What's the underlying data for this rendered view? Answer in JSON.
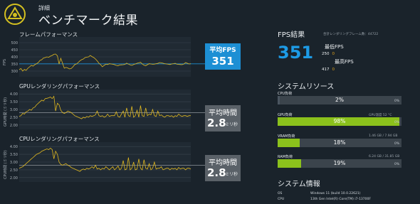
{
  "header": {
    "subtitle": "詳細",
    "title": "ベンチマーク結果"
  },
  "left": {
    "frame": {
      "title": "フレームパフォーマンス",
      "ylabel": "FPS",
      "ticks": [
        "500",
        "450",
        "400",
        "350",
        "300"
      ],
      "stat_label": "平均FPS",
      "stat_value": "351",
      "series": [
        310,
        318,
        300,
        312,
        305,
        320,
        330,
        340,
        335,
        345,
        352,
        360,
        375,
        380,
        392,
        395,
        400,
        397,
        405,
        410,
        418,
        420,
        408,
        350,
        390,
        355,
        320,
        326,
        322,
        315,
        318,
        330,
        345,
        350,
        360,
        372,
        380,
        385,
        395,
        398,
        400,
        410,
        402,
        395,
        385,
        372,
        355,
        345,
        330,
        340,
        348,
        346,
        352,
        350,
        348,
        345,
        340,
        338,
        343,
        344,
        345,
        347,
        356,
        349,
        344,
        340,
        346,
        350,
        355,
        358,
        362,
        350,
        341,
        338,
        345,
        352,
        350,
        348,
        349,
        352,
        354,
        360,
        358,
        355,
        352,
        350,
        348,
        346,
        350,
        352,
        355,
        348,
        347,
        346,
        345,
        350,
        360,
        355,
        350,
        352
      ]
    },
    "gpu": {
      "title": "GPUレンダリングパフォーマンス",
      "ylabel": "GPU時間 (ミリ秒)",
      "ticks": [
        "4.00",
        "3.50",
        "3.00",
        "2.50",
        "2.00"
      ],
      "stat_label": "平均時間",
      "stat_value": "2.8",
      "stat_unit": "ミリ秒",
      "series": [
        2.55,
        2.6,
        2.75,
        2.7,
        2.85,
        2.9,
        3.0,
        2.95,
        3.1,
        3.15,
        3.3,
        3.4,
        3.5,
        3.6,
        3.55,
        3.7,
        3.72,
        3.75,
        3.8,
        3.7,
        3.85,
        2.9,
        3.4,
        3.3,
        2.95,
        2.8,
        2.75,
        2.8,
        2.9,
        2.85,
        2.8,
        2.7,
        2.6,
        2.55,
        2.5,
        2.45,
        2.4,
        2.5,
        2.45,
        2.55,
        2.5,
        2.6,
        2.55,
        2.6,
        2.65,
        2.9,
        2.6,
        2.55,
        2.6,
        2.5,
        2.55,
        2.7,
        2.55,
        2.6,
        2.6,
        2.6,
        2.85,
        2.55,
        2.5,
        2.7,
        2.9,
        2.5,
        3.1,
        2.6,
        2.55,
        3.2,
        2.5,
        2.6,
        2.95,
        2.5,
        3.25,
        2.6,
        2.55,
        3.1,
        2.6,
        2.7,
        2.65,
        3.0,
        2.6,
        2.55,
        2.9,
        2.6,
        2.65,
        2.55,
        2.5,
        2.6,
        2.6,
        2.55,
        2.6,
        2.5,
        2.6,
        2.55,
        2.7,
        2.6,
        2.55,
        2.6,
        2.6,
        2.55,
        2.6,
        2.6
      ]
    },
    "cpu": {
      "title": "CPUレンダリングパフォーマンス",
      "ylabel": "CPU時間 (ミリ秒)",
      "ticks": [
        "4.00",
        "3.50",
        "3.00",
        "2.50",
        "2.00"
      ],
      "stat_label": "平均時間",
      "stat_value": "2.8",
      "stat_unit": "ミリ秒",
      "series": [
        2.6,
        2.65,
        2.7,
        2.8,
        2.9,
        3.0,
        3.1,
        3.2,
        3.3,
        3.4,
        3.5,
        3.55,
        3.6,
        3.7,
        3.75,
        3.8,
        3.85,
        3.8,
        3.9,
        3.8,
        3.2,
        3.7,
        3.5,
        3.0,
        2.85,
        2.8,
        2.85,
        2.9,
        2.8,
        2.75,
        2.65,
        2.6,
        2.55,
        2.5,
        2.45,
        2.4,
        2.5,
        2.55,
        2.5,
        2.6,
        2.55,
        2.6,
        2.7,
        2.6,
        2.8,
        2.55,
        2.6,
        2.5,
        2.6,
        2.55,
        2.7,
        2.6,
        2.5,
        2.6,
        2.7,
        2.5,
        2.6,
        2.75,
        2.5,
        2.6,
        3.1,
        2.5,
        2.55,
        3.3,
        2.5,
        2.6,
        3.0,
        2.5,
        2.55,
        3.2,
        2.6,
        2.5,
        3.15,
        2.6,
        2.55,
        2.9,
        2.5,
        2.6,
        3.0,
        2.55,
        2.6,
        2.6,
        2.7,
        2.5,
        2.55,
        2.6,
        2.6,
        2.5,
        2.6,
        2.55,
        2.6,
        2.5,
        2.65,
        2.55,
        2.6,
        2.6,
        2.5,
        2.6,
        2.6,
        2.55
      ]
    }
  },
  "right": {
    "fps_heading": "FPS結果",
    "total_frames_label": "合計レンダリングフレーム数：44722",
    "fps_value": "351",
    "min_label": "最低FPS",
    "min_value": "250",
    "min_zero": "0",
    "max_label": "最高FPS",
    "max_value": "417",
    "max_zero": "0",
    "res_heading": "システムリソース",
    "resources": [
      {
        "label": "CPU負荷",
        "value": "2%",
        "percent": 2,
        "color": "#4a5560",
        "extra": "",
        "zero": "0%"
      },
      {
        "label": "GPU負荷",
        "value": "98%",
        "percent": 98,
        "color": "#8bc11c",
        "extra": "GPU温度 52 °C",
        "zero": "0%"
      },
      {
        "label": "VRAM負荷",
        "value": "18%",
        "percent": 18,
        "color": "#8bc11c",
        "extra": "1.46 GB / 7.94 GB",
        "zero": "0%"
      },
      {
        "label": "RAM負荷",
        "value": "19%",
        "percent": 19,
        "color": "#8bc11c",
        "extra": "6.24 GB / 31.85 GB",
        "zero": "0%"
      }
    ],
    "sys_heading": "システム情報",
    "sys": [
      {
        "key": "OS",
        "value": "Windows 11 (build 10.0.22621)"
      },
      {
        "key": "CPU",
        "value": "13th Gen Intel(R) Core(TM) i7-13700F"
      }
    ]
  }
}
